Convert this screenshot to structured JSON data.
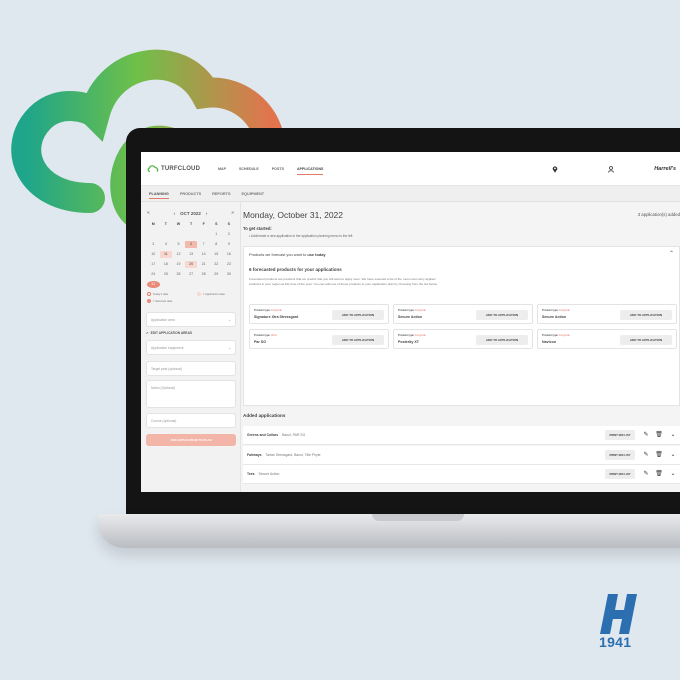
{
  "nav": {
    "brand": "TURFCLOUD",
    "items": [
      "MAP",
      "SCHEDULE",
      "POSTS",
      "APPLICATIONS"
    ],
    "active": "APPLICATIONS",
    "company": "Harrell's"
  },
  "subnav": {
    "items": [
      "PLANNING",
      "PRODUCTS",
      "REPORTS",
      "EQUIPMENT"
    ],
    "active": "PLANNING"
  },
  "calendar": {
    "month_label": "OCT 2022",
    "dow": [
      "M",
      "T",
      "W",
      "T",
      "F",
      "S",
      "S"
    ],
    "weeks": [
      [
        "",
        "",
        "",
        "",
        "",
        "1",
        "2"
      ],
      [
        "3",
        "4",
        "5",
        "6",
        "7",
        "8",
        "9"
      ],
      [
        "10",
        "11",
        "12",
        "13",
        "14",
        "15",
        "16"
      ],
      [
        "17",
        "18",
        "19",
        "20",
        "21",
        "22",
        "23"
      ],
      [
        "24",
        "25",
        "26",
        "27",
        "28",
        "29",
        "30"
      ],
      [
        "31",
        "",
        "",
        "",
        "",
        "",
        ""
      ]
    ],
    "legend_today": "Today's date",
    "legend_app": "= Application date",
    "legend_selected": "= Selected date"
  },
  "form": {
    "application_area_placeholder": "Application area",
    "edit_areas_label": "EDIT APPLICATION AREAS",
    "equipment_placeholder": "Application equipment",
    "target_pest_placeholder": "Target pest (optional)",
    "notes_placeholder": "Notes (Optional)",
    "course_placeholder": "Course (optional)",
    "add_button": "ADD APPLICATION TO PLAN"
  },
  "main": {
    "date_title": "Monday, October 31, 2022",
    "app_count": "3 application(s) added",
    "started_title": "To get started:",
    "started_note": "• Add/create a new application in the application planning menu to the left",
    "forecast_card_title_pre": "Products we forecast you want to ",
    "forecast_card_title_bold": "use today",
    "forecast_heading": "6 forecasted products for your applications",
    "forecast_desc": "Forecasted products are products that we predict that you will want to apply soon. We have selected a list of the most commonly applied products in your region at this time of the year. You can add one of these products to your application plan by choosing from the list below.",
    "add_to_app_label": "ADD TO APPLICATION",
    "products": [
      {
        "type_label": "Product type",
        "type": "Fungicide",
        "name": "Signature Xtra Stressgard"
      },
      {
        "type_label": "Product type",
        "type": "Fungicide",
        "name": "Secure Action"
      },
      {
        "type_label": "Product type",
        "type": "Fungicide",
        "name": "Secure Action"
      },
      {
        "type_label": "Product type",
        "type": "Other",
        "name": "Par SG"
      },
      {
        "type_label": "Product type",
        "type": "Fungicide",
        "name": "Posterity XT"
      },
      {
        "type_label": "Product type",
        "type": "Fungicide",
        "name": "Navicon"
      }
    ],
    "added_title": "Added applications",
    "print_label": "PRINT MIX LIST",
    "applications": [
      {
        "area": "Greens and Collars",
        "products": "Banol, PAR SG"
      },
      {
        "area": "Fairways",
        "products": "Tartan Stressgard, Banol, Title Phyte"
      },
      {
        "area": "Tees",
        "products": "Secure Action"
      }
    ]
  },
  "brand_logo": {
    "year": "1941"
  },
  "colors": {
    "accent": "#e07b6a",
    "background": "#dfe7ef",
    "logo_blue": "#2b6fb0"
  }
}
